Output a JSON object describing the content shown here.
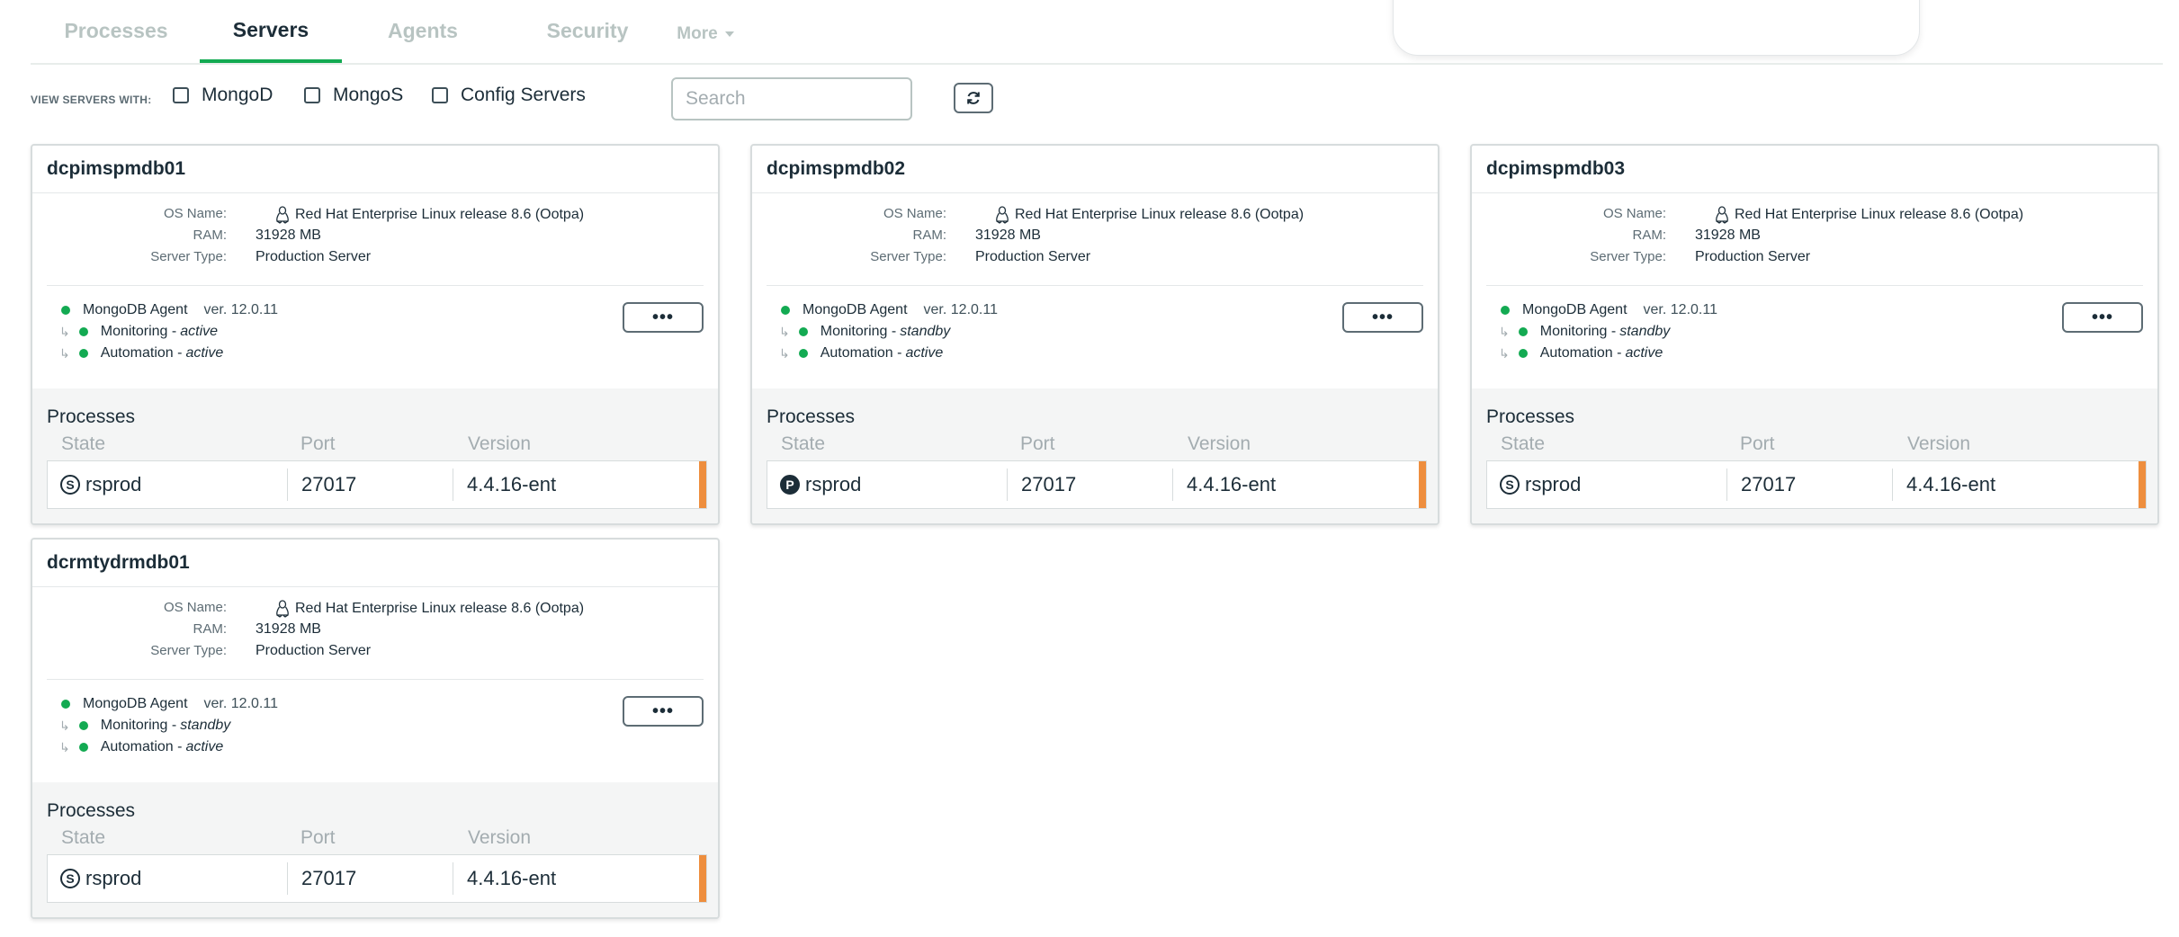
{
  "tabs": [
    {
      "label": "Processes",
      "active": false
    },
    {
      "label": "Servers",
      "active": true
    },
    {
      "label": "Agents",
      "active": false
    },
    {
      "label": "Security",
      "active": false
    }
  ],
  "more_label": "More",
  "filter": {
    "label": "VIEW SERVERS WITH:",
    "options": [
      {
        "label": "MongoD",
        "checked": false
      },
      {
        "label": "MongoS",
        "checked": false
      },
      {
        "label": "Config Servers",
        "checked": false
      }
    ],
    "search_placeholder": "Search"
  },
  "labels": {
    "os_name": "OS Name:",
    "ram": "RAM:",
    "server_type": "Server Type:",
    "processes": "Processes",
    "col_state": "State",
    "col_port": "Port",
    "col_version": "Version",
    "monitoring": "Monitoring - ",
    "automation": "Automation - ",
    "dots": "•••"
  },
  "colors": {
    "status_green": "#13aa52",
    "accent_orange": "#ee8e3e",
    "tab_active_underline": "#13aa52"
  },
  "servers": [
    {
      "name": "dcpimspmdb01",
      "os_name": "Red Hat Enterprise Linux release 8.6 (Ootpa)",
      "ram": "31928 MB",
      "server_type": "Production Server",
      "agent": "MongoDB Agent",
      "agent_version": "ver. 12.0.11",
      "monitoring": "active",
      "automation": "active",
      "process": {
        "state_icon": "S",
        "name": "rsprod",
        "port": "27017",
        "version": "4.4.16-ent"
      }
    },
    {
      "name": "dcpimspmdb02",
      "os_name": "Red Hat Enterprise Linux release 8.6 (Ootpa)",
      "ram": "31928 MB",
      "server_type": "Production Server",
      "agent": "MongoDB Agent",
      "agent_version": "ver. 12.0.11",
      "monitoring": "standby",
      "automation": "active",
      "process": {
        "state_icon": "P",
        "name": "rsprod",
        "port": "27017",
        "version": "4.4.16-ent"
      }
    },
    {
      "name": "dcpimspmdb03",
      "os_name": "Red Hat Enterprise Linux release 8.6 (Ootpa)",
      "ram": "31928 MB",
      "server_type": "Production Server",
      "agent": "MongoDB Agent",
      "agent_version": "ver. 12.0.11",
      "monitoring": "standby",
      "automation": "active",
      "process": {
        "state_icon": "S",
        "name": "rsprod",
        "port": "27017",
        "version": "4.4.16-ent"
      }
    },
    {
      "name": "dcrmtydrmdb01",
      "os_name": "Red Hat Enterprise Linux release 8.6 (Ootpa)",
      "ram": "31928 MB",
      "server_type": "Production Server",
      "agent": "MongoDB Agent",
      "agent_version": "ver. 12.0.11",
      "monitoring": "standby",
      "automation": "active",
      "process": {
        "state_icon": "S",
        "name": "rsprod",
        "port": "27017",
        "version": "4.4.16-ent"
      }
    }
  ]
}
